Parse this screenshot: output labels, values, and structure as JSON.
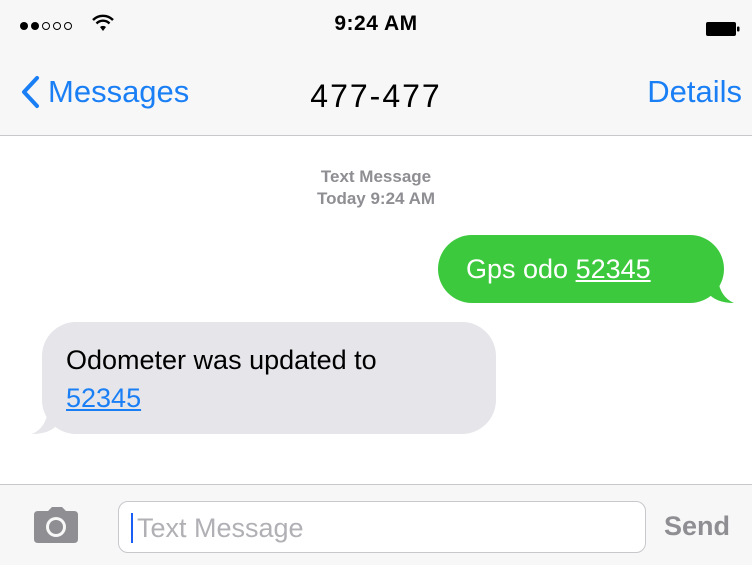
{
  "status_bar": {
    "time": "9:24 AM",
    "signal_bars_filled": 2,
    "signal_bars_total": 5
  },
  "nav": {
    "back_label": "Messages",
    "title": "477-477",
    "details_label": "Details"
  },
  "conversation": {
    "header_line1": "Text Message",
    "header_line2": "Today 9:24 AM",
    "messages": [
      {
        "direction": "outgoing",
        "text": "Gps odo ",
        "link": "52345"
      },
      {
        "direction": "incoming",
        "text": "Odometer was updated to",
        "link": "52345"
      }
    ]
  },
  "input_bar": {
    "placeholder": "Text Message",
    "send_label": "Send"
  },
  "colors": {
    "accent_blue": "#1a7ff5",
    "outgoing_bubble": "#3dc93e",
    "incoming_bubble": "#e5e5ea",
    "bar_background": "#f7f7f7"
  },
  "icons": [
    "wifi-icon",
    "battery-icon",
    "chevron-left-icon",
    "camera-icon"
  ]
}
